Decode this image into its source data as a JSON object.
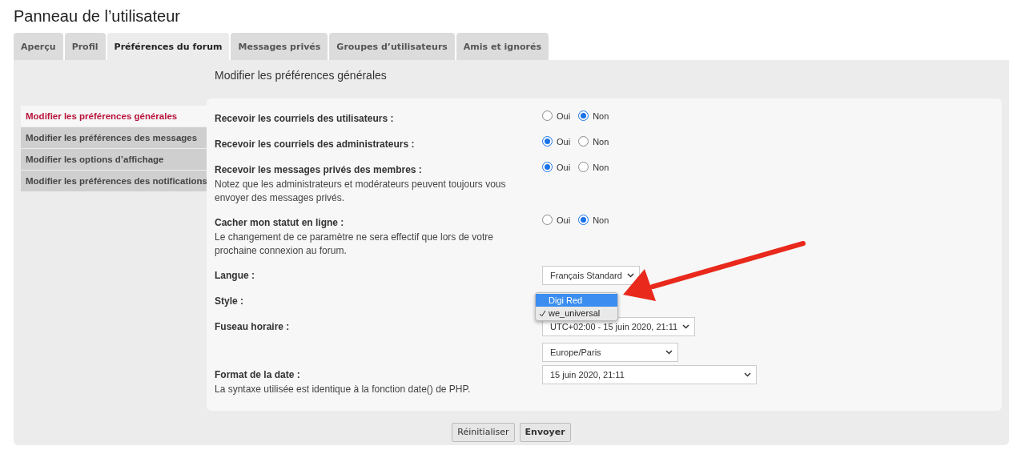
{
  "page_title": "Panneau de l’utilisateur",
  "tabs": [
    {
      "label": "Aperçu",
      "selected": false
    },
    {
      "label": "Profil",
      "selected": false
    },
    {
      "label": "Préférences du forum",
      "selected": true
    },
    {
      "label": "Messages privés",
      "selected": false
    },
    {
      "label": "Groupes d’utilisateurs",
      "selected": false
    },
    {
      "label": "Amis et ignorés",
      "selected": false
    }
  ],
  "panel_heading": "Modifier les préférences générales",
  "sidebar": {
    "items": [
      {
        "label": "Modifier les préférences générales",
        "selected": true
      },
      {
        "label": "Modifier les préférences des messages",
        "selected": false
      },
      {
        "label": "Modifier les options d’affichage",
        "selected": false
      },
      {
        "label": "Modifier les préférences des notifications",
        "selected": false
      }
    ]
  },
  "settings": [
    {
      "kind": "radio",
      "label": "Recevoir les courriels des utilisateurs :",
      "options": [
        {
          "label": "Oui",
          "selected": false
        },
        {
          "label": "Non",
          "selected": true
        }
      ]
    },
    {
      "kind": "radio",
      "label": "Recevoir les courriels des administrateurs :",
      "options": [
        {
          "label": "Oui",
          "selected": true
        },
        {
          "label": "Non",
          "selected": false
        }
      ]
    },
    {
      "kind": "radio",
      "label": "Recevoir les messages privés des membres :",
      "note": "Notez que les administrateurs et modérateurs peuvent toujours vous envoyer des messages privés.",
      "options": [
        {
          "label": "Oui",
          "selected": true
        },
        {
          "label": "Non",
          "selected": false
        }
      ]
    },
    {
      "kind": "radio",
      "label": "Cacher mon statut en ligne :",
      "note": "Le changement de ce paramètre ne sera effectif que lors de votre prochaine connexion au forum.",
      "options": [
        {
          "label": "Oui",
          "selected": false
        },
        {
          "label": "Non",
          "selected": true
        }
      ]
    },
    {
      "kind": "select",
      "label": "Langue :",
      "selects": [
        "Français Standard"
      ]
    },
    {
      "kind": "dropdown",
      "label": "Style :",
      "options": [
        {
          "label": "Digi Red",
          "highlighted": true,
          "checked": false
        },
        {
          "label": "we_universal",
          "highlighted": false,
          "checked": true
        }
      ]
    },
    {
      "kind": "select",
      "label": "Fuseau horaire :",
      "selects": [
        "UTC+02:00 - 15 juin 2020, 21:11",
        "Europe/Paris"
      ]
    },
    {
      "kind": "select",
      "label": "Format de la date :",
      "note": "La syntaxe utilisée est identique à la fonction date() de PHP.",
      "selects": [
        "15 juin 2020, 21:11"
      ]
    }
  ],
  "buttons": [
    {
      "label": "Réinitialiser",
      "primary": false
    },
    {
      "label": "Envoyer",
      "primary": true
    }
  ]
}
